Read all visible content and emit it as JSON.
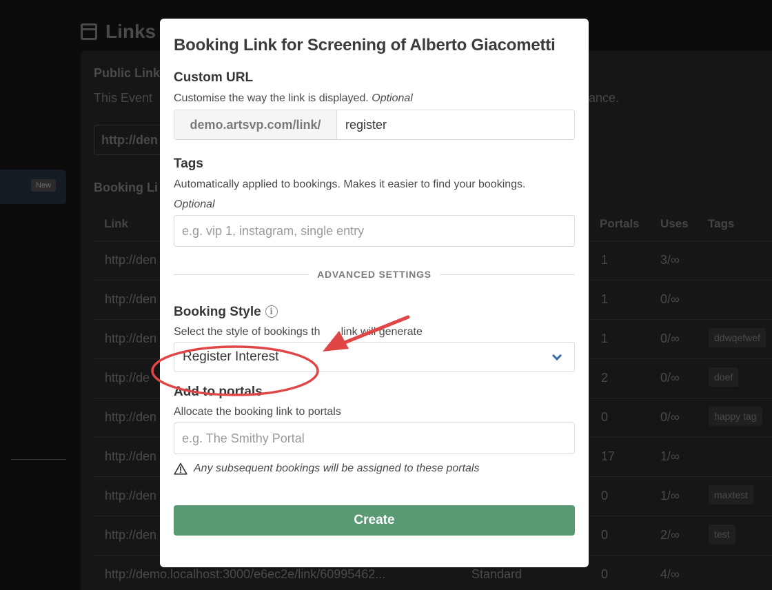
{
  "background": {
    "page_title": "Links",
    "sidebar_badge": "New",
    "public_link": {
      "heading": "Public Link",
      "description_start": "This Event",
      "description_end": "ance.",
      "url_fragment": "http://den"
    },
    "booking_links": {
      "heading": "Booking Li",
      "columns": {
        "link": "Link",
        "portals": "Portals",
        "uses": "Uses",
        "tags": "Tags"
      },
      "rows": [
        {
          "link": "http://den",
          "portals": "1",
          "uses": "3/∞",
          "tag": ""
        },
        {
          "link": "http://den",
          "portals": "1",
          "uses": "0/∞",
          "tag": ""
        },
        {
          "link": "http://den",
          "portals": "1",
          "uses": "0/∞",
          "tag": "ddwqefwef"
        },
        {
          "link": "http://de",
          "portals": "2",
          "uses": "0/∞",
          "tag": "doef"
        },
        {
          "link": "http://den",
          "portals": "0",
          "uses": "0/∞",
          "tag": "happy tag"
        },
        {
          "link": "http://den",
          "portals": "17",
          "uses": "1/∞",
          "tag": ""
        },
        {
          "link": "http://den",
          "portals": "0",
          "uses": "1/∞",
          "tag": "maxtest"
        },
        {
          "link": "http://den",
          "portals": "0",
          "uses": "2/∞",
          "tag": "test"
        },
        {
          "link": "http://demo.localhost:3000/e6ec2e/link/60995462...",
          "style": "Standard",
          "portals": "0",
          "uses": "4/∞",
          "tag": ""
        }
      ]
    }
  },
  "modal": {
    "title": "Booking Link for Screening of Alberto Giacometti",
    "custom_url": {
      "label": "Custom URL",
      "help": "Customise the way the link is displayed.",
      "optional": "Optional",
      "prefix": "demo.artsvp.com/link/",
      "value": "register"
    },
    "tags": {
      "label": "Tags",
      "help": "Automatically applied to bookings. Makes it easier to find your bookings.",
      "optional": "Optional",
      "placeholder": "e.g. vip 1, instagram, single entry"
    },
    "advanced_divider": "ADVANCED SETTINGS",
    "booking_style": {
      "label": "Booking Style",
      "help_before": "Select the style of bookings th",
      "help_after": "link will generate",
      "selected": "Register Interest"
    },
    "portals": {
      "label": "Add to portals",
      "help": "Allocate the booking link to portals",
      "placeholder": "e.g. The Smithy Portal",
      "warning": "Any subsequent bookings will be assigned to these portals"
    },
    "create_button": "Create"
  },
  "annotation_color": "#e04646",
  "icons": {
    "calendar": "calendar-icon",
    "info": "info-icon",
    "chevron": "chevron-down-icon",
    "warning": "warning-icon"
  }
}
